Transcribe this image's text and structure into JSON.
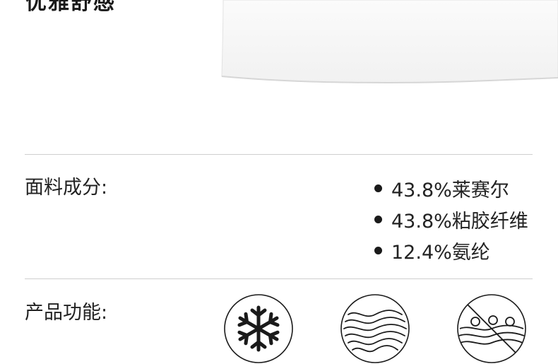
{
  "header": {
    "heading": "优雅舒感"
  },
  "fabric": {
    "label": "面料成分:",
    "items": [
      "43.8%莱赛尔",
      "43.8%粘胶纤维",
      "12.4%氨纶"
    ]
  },
  "features": {
    "label": "产品功能:",
    "icons": [
      "snowflake-icon",
      "wave-lines-icon",
      "no-pilling-icon"
    ]
  },
  "colors": {
    "text": "#1a1a1a",
    "divider": "#cfcfcf",
    "garment": "#f6f6f6"
  }
}
